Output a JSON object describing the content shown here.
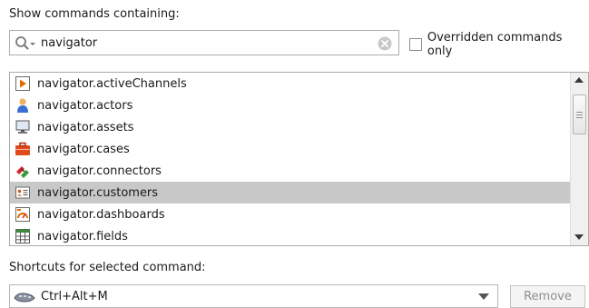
{
  "search": {
    "label": "Show commands containing:",
    "value": "navigator"
  },
  "override": {
    "label": "Overridden commands only",
    "checked": false
  },
  "commands": {
    "items": [
      {
        "label": "navigator.activeChannels",
        "icon": "play-channel-icon"
      },
      {
        "label": "navigator.actors",
        "icon": "person-icon"
      },
      {
        "label": "navigator.assets",
        "icon": "monitor-icon"
      },
      {
        "label": "navigator.cases",
        "icon": "briefcase-icon"
      },
      {
        "label": "navigator.connectors",
        "icon": "connector-icon"
      },
      {
        "label": "navigator.customers",
        "icon": "customer-card-icon",
        "selected": true
      },
      {
        "label": "navigator.dashboards",
        "icon": "dashboard-icon"
      },
      {
        "label": "navigator.fields",
        "icon": "grid-icon"
      }
    ]
  },
  "shortcuts": {
    "label": "Shortcuts for selected command:",
    "value": "Ctrl+Alt+M",
    "icon": "keyboard-icon"
  },
  "buttons": {
    "remove": "Remove"
  },
  "colors": {
    "selected_row": "#c8c8c8",
    "disabled_text": "#8f8f8f"
  }
}
